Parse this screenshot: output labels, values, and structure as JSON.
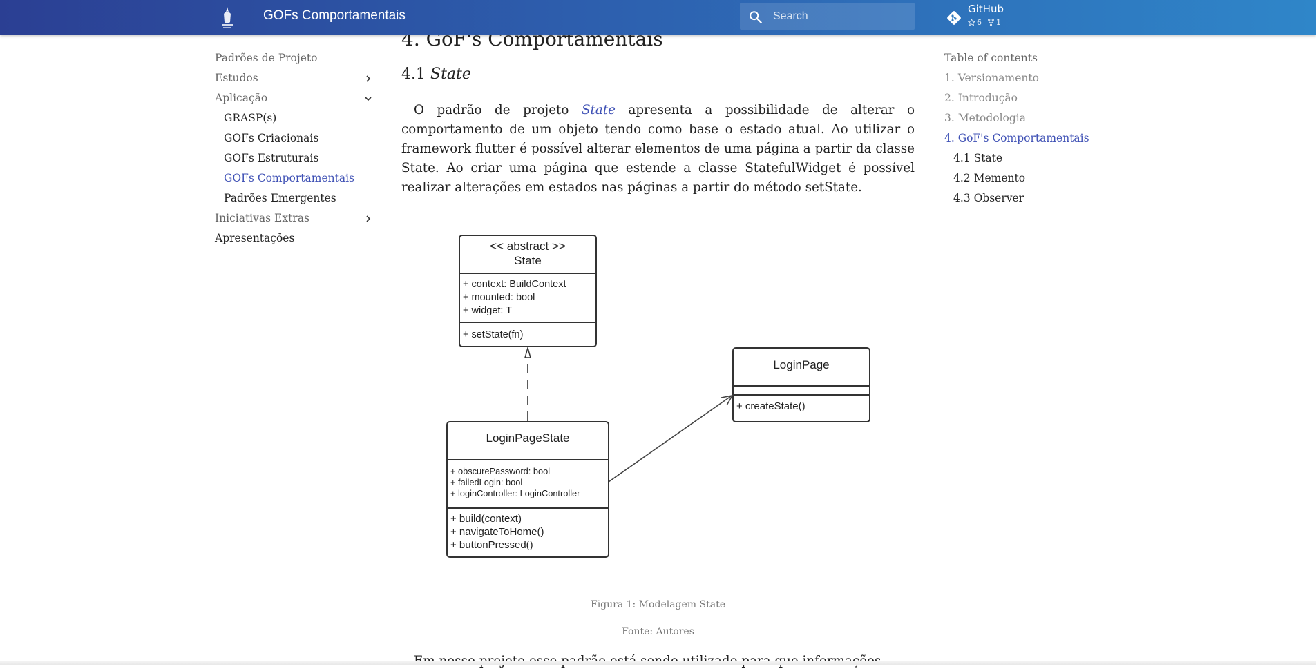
{
  "header": {
    "site_title": "GOFs Comportamentais",
    "search_placeholder": "Search",
    "repo_name": "GitHub",
    "stars": "6",
    "forks": "1"
  },
  "nav": {
    "items": [
      {
        "label": "Padrões de Projeto"
      },
      {
        "label": "Estudos"
      },
      {
        "label": "Aplicação"
      },
      {
        "label": "GRASP(s)"
      },
      {
        "label": "GOFs Criacionais"
      },
      {
        "label": "GOFs Estruturais"
      },
      {
        "label": "GOFs Comportamentais"
      },
      {
        "label": "Padrões Emergentes"
      },
      {
        "label": "Iniciativas Extras"
      },
      {
        "label": "Apresentações"
      }
    ]
  },
  "content": {
    "h1": "4. GoF's Comportamentais",
    "h2_number": "4.1",
    "h2_title": "State",
    "para_before": "O padrão de projeto ",
    "para_link": "State",
    "para_after": " apresenta a possibilidade de alterar o comportamento de um objeto tendo como base o estado atual. Ao utilizar o framework flutter é possível alterar elementos de uma página a partir da classe State. Ao criar uma página que estende a classe StatefulWidget é possível realizar alterações em estados nas páginas a partir do método setState.",
    "caption": "Figura 1: Modelagem State",
    "source": "Fonte: Autores",
    "para2": "Em nosso projeto esse padrão está sendo utilizado para que informações"
  },
  "uml": {
    "state_stereotype": "<< abstract >>",
    "state_name": "State",
    "state_attrs": [
      "+ context: BuildContext",
      "+ mounted: bool",
      "+ widget: T"
    ],
    "state_methods": [
      "+ setState(fn)"
    ],
    "loginpage_name": "LoginPage",
    "loginpage_methods": [
      "+ createState()"
    ],
    "lps_name": "LoginPageState",
    "lps_attrs": [
      "+ obscurePassword: bool",
      "+ failedLogin: bool",
      "+ loginController: LoginController"
    ],
    "lps_methods": [
      "+ build(context)",
      "+ navigateToHome()",
      "+ buttonPressed()"
    ]
  },
  "toc": {
    "title": "Table of contents",
    "items": [
      {
        "label": "1. Versionamento"
      },
      {
        "label": "2. Introdução"
      },
      {
        "label": "3. Metodologia"
      },
      {
        "label": "4. GoF's Comportamentais"
      },
      {
        "label": "4.1 State"
      },
      {
        "label": "4.2 Memento"
      },
      {
        "label": "4.3 Observer"
      }
    ]
  }
}
